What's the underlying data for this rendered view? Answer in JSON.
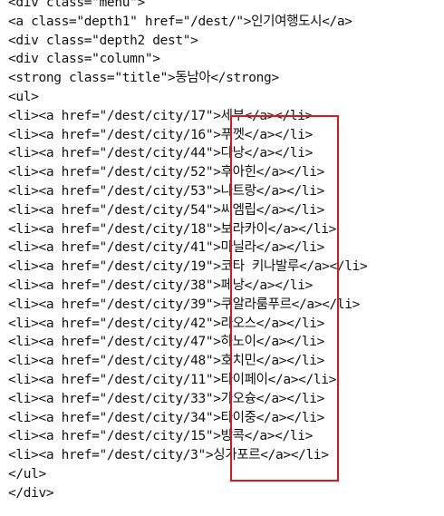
{
  "code_lines": [
    "<div class=\"menu\">",
    "<a class=\"depth1\" href=\"/dest/\">인기여행도시</a>",
    "<div class=\"depth2 dest\">",
    "<div class=\"column\">",
    "<strong class=\"title\">동남아</strong>",
    "<ul>",
    "<li><a href=\"/dest/city/17\">세부</a></li>",
    "<li><a href=\"/dest/city/16\">푸껫</a></li>",
    "<li><a href=\"/dest/city/44\">다낭</a></li>",
    "<li><a href=\"/dest/city/52\">후아힌</a></li>",
    "<li><a href=\"/dest/city/53\">나트랑</a></li>",
    "<li><a href=\"/dest/city/54\">씨엠립</a></li>",
    "<li><a href=\"/dest/city/18\">보라카이</a></li>",
    "<li><a href=\"/dest/city/41\">마닐라</a></li>",
    "<li><a href=\"/dest/city/19\">코타 키나발루</a></li>",
    "<li><a href=\"/dest/city/38\">페낭</a></li>",
    "<li><a href=\"/dest/city/39\">쿠알라룸푸르</a></li>",
    "<li><a href=\"/dest/city/42\">라오스</a></li>",
    "<li><a href=\"/dest/city/47\">하노이</a></li>",
    "<li><a href=\"/dest/city/48\">호치민</a></li>",
    "<li><a href=\"/dest/city/11\">타이페이</a></li>",
    "<li><a href=\"/dest/city/33\">가오슝</a></li>",
    "<li><a href=\"/dest/city/34\">타이중</a></li>",
    "<li><a href=\"/dest/city/15\">방콕</a></li>",
    "<li><a href=\"/dest/city/3\">싱가포르</a></li>",
    "</ul>",
    "</div>"
  ],
  "highlight": {
    "color": "#e0141e"
  }
}
